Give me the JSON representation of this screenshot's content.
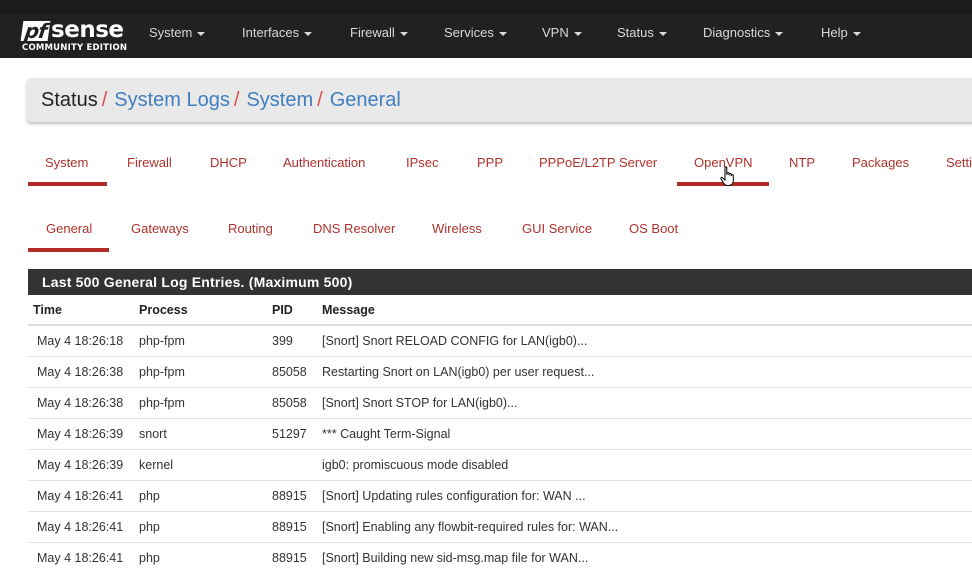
{
  "brand": {
    "logo_mark": "pf",
    "logo_text": "sense",
    "edition": "COMMUNITY EDITION"
  },
  "nav": [
    {
      "label": "System"
    },
    {
      "label": "Interfaces"
    },
    {
      "label": "Firewall"
    },
    {
      "label": "Services"
    },
    {
      "label": "VPN"
    },
    {
      "label": "Status"
    },
    {
      "label": "Diagnostics"
    },
    {
      "label": "Help"
    }
  ],
  "breadcrumb": {
    "root": "Status",
    "separator": "/",
    "links": [
      "System Logs",
      "System",
      "General"
    ]
  },
  "tabs_primary": {
    "active": "System",
    "items": [
      "System",
      "Firewall",
      "DHCP",
      "Authentication",
      "IPsec",
      "PPP",
      "PPPoE/L2TP Server",
      "OpenVPN",
      "NTP",
      "Packages",
      "Setti"
    ]
  },
  "tabs_secondary": {
    "active": "General",
    "items": [
      "General",
      "Gateways",
      "Routing",
      "DNS Resolver",
      "Wireless",
      "GUI Service",
      "OS Boot"
    ]
  },
  "log": {
    "title": "Last 500 General Log Entries. (Maximum 500)",
    "columns": [
      "Time",
      "Process",
      "PID",
      "Message"
    ],
    "rows": [
      [
        "May 4 18:26:18",
        "php-fpm",
        "399",
        "[Snort] Snort RELOAD CONFIG for LAN(igb0)..."
      ],
      [
        "May 4 18:26:38",
        "php-fpm",
        "85058",
        "Restarting Snort on LAN(igb0) per user request..."
      ],
      [
        "May 4 18:26:38",
        "php-fpm",
        "85058",
        "[Snort] Snort STOP for LAN(igb0)..."
      ],
      [
        "May 4 18:26:39",
        "snort",
        "51297",
        "*** Caught Term-Signal"
      ],
      [
        "May 4 18:26:39",
        "kernel",
        "",
        "igb0: promiscuous mode disabled"
      ],
      [
        "May 4 18:26:41",
        "php",
        "88915",
        "[Snort] Updating rules configuration for: WAN ..."
      ],
      [
        "May 4 18:26:41",
        "php",
        "88915",
        "[Snort] Enabling any flowbit-required rules for: WAN..."
      ],
      [
        "May 4 18:26:41",
        "php",
        "88915",
        "[Snort] Building new sid-msg.map file for WAN..."
      ]
    ]
  },
  "colors": {
    "navbar": "#212121",
    "accent_red": "#b52b27",
    "link_blue": "#3f7fc1",
    "panel_head": "#333333"
  },
  "icons": {
    "dropdown": "caret-down-icon",
    "cursor": "hand-pointer-icon"
  }
}
